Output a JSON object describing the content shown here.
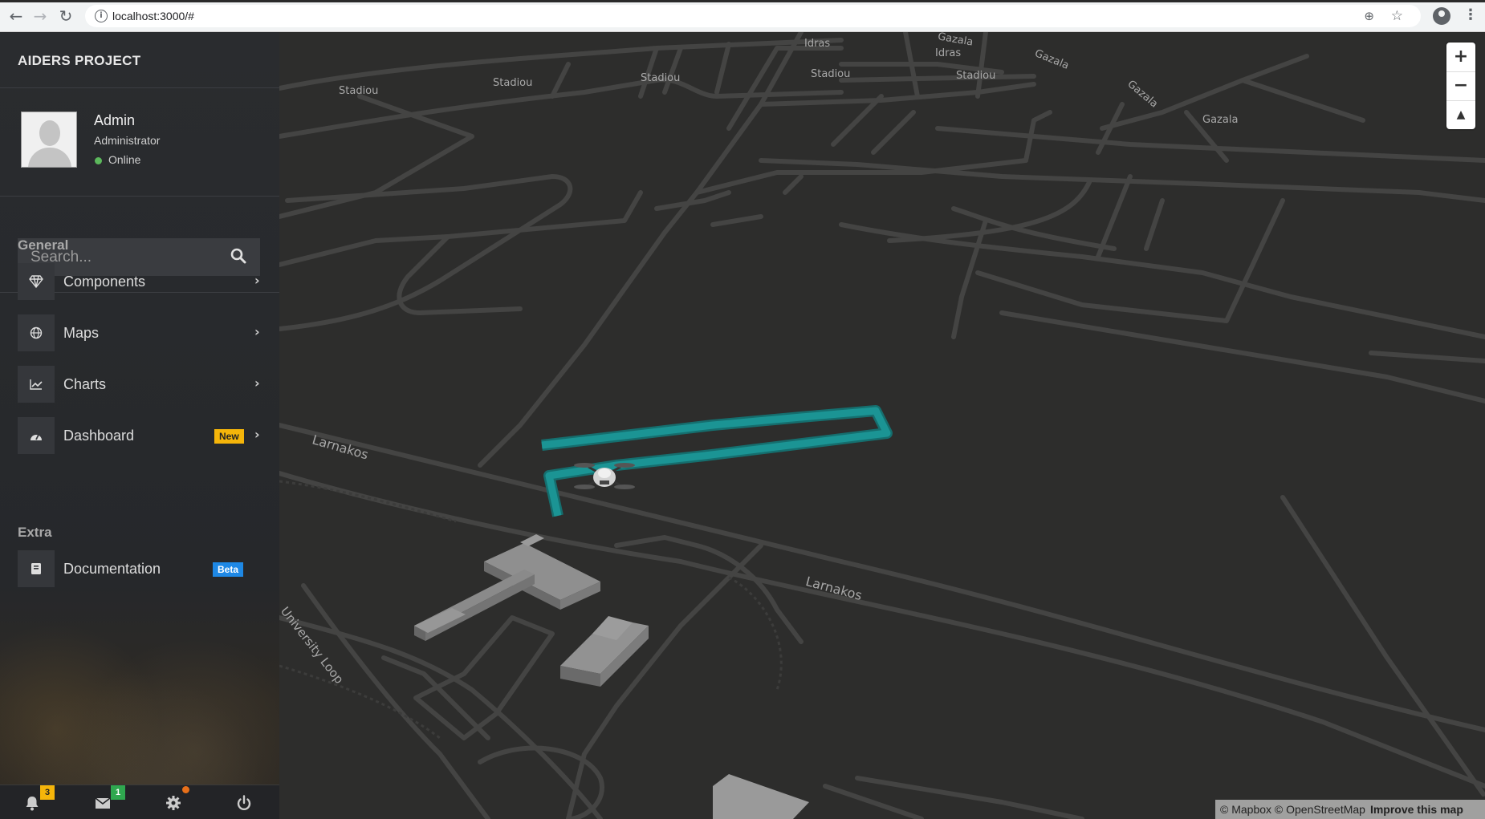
{
  "browser": {
    "url": "localhost:3000/#"
  },
  "sidebar": {
    "brand": "AIDERS PROJECT",
    "profile": {
      "name": "Admin",
      "role": "Administrator",
      "status": "Online",
      "status_color": "#5cb85c"
    },
    "search": {
      "placeholder": "Search..."
    },
    "sections": {
      "general": "General",
      "extra": "Extra"
    },
    "items": [
      {
        "label": "Components",
        "icon": "diamond-icon"
      },
      {
        "label": "Maps",
        "icon": "globe-icon"
      },
      {
        "label": "Charts",
        "icon": "line-chart-icon"
      },
      {
        "label": "Dashboard",
        "icon": "tachometer-icon",
        "badge": "New"
      },
      {
        "label": "Documentation",
        "icon": "book-icon",
        "badge": "Beta"
      }
    ],
    "footer": {
      "notifications_count": "3",
      "messages_count": "1"
    }
  },
  "map": {
    "street_labels": [
      "Stadiou",
      "Stadiou",
      "Stadiou",
      "Stadiou",
      "Stadiou",
      "Idras",
      "Idras",
      "Gazala",
      "Gazala",
      "Gazala",
      "Gazala",
      "Larnakos",
      "Larnakos",
      "University Loop"
    ],
    "zoom_in": "+",
    "zoom_out": "−",
    "compass": "▲",
    "attribution": "© Mapbox © OpenStreetMap",
    "improve": "Improve this map",
    "path_color": "#1a8f8f"
  }
}
